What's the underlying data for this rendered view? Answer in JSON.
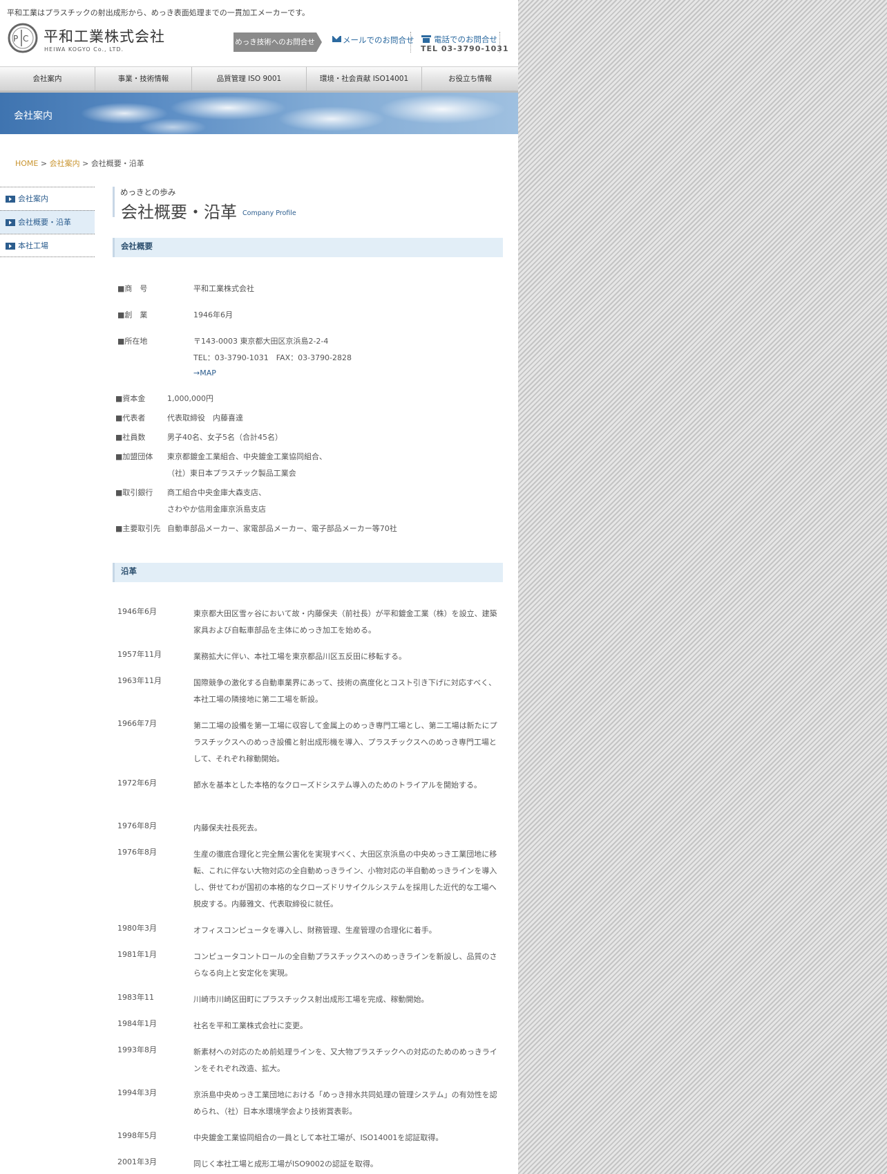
{
  "header": {
    "tagline": "平和工業はプラスチックの射出成形から、めっき表面処理までの一貫加工メーカーです。",
    "logo_name": "平和工業株式会社",
    "logo_sub": "HEIWA KOGYO Co., LTD.",
    "tech_contact": "めっき技術へのお問合せ",
    "mail_contact": "メールでのお問合せ",
    "phone_contact": "電話でのお問合せ",
    "phone_number": "TEL 03-3790-1031"
  },
  "nav": {
    "items": [
      {
        "label": "会社案内"
      },
      {
        "label": "事業・技術情報"
      },
      {
        "label": "品質管理 ISO 9001"
      },
      {
        "label": "環境・社会貢献 ISO14001"
      },
      {
        "label": "お役立ち情報"
      }
    ]
  },
  "banner": {
    "title": "会社案内"
  },
  "breadcrumb": {
    "home": "HOME",
    "sep": " > ",
    "parent": "会社案内",
    "current": "会社概要・沿革"
  },
  "sidebar": {
    "items": [
      {
        "label": "会社案内"
      },
      {
        "label": "会社概要・沿革"
      },
      {
        "label": "本社工場"
      }
    ]
  },
  "page_title": {
    "sub": "めっきとの歩み",
    "main": "会社概要・沿革",
    "en": "Company Profile"
  },
  "overview": {
    "heading": "会社概要",
    "rows": [
      {
        "key": "■商　号",
        "lines": [
          "平和工業株式会社"
        ]
      },
      {
        "key": "■創　業",
        "lines": [
          "1946年6月"
        ]
      },
      {
        "key": "■所在地",
        "lines": [
          "〒143-0003 東京都大田区京浜島2-2-4",
          "TEL：03-3790-1031　FAX：03-3790-2828"
        ],
        "link": "→MAP"
      },
      {
        "key": "■資本金",
        "lines": [
          "1,000,000円"
        ]
      },
      {
        "key": "■代表者",
        "lines": [
          "代表取締役　内藤喜達"
        ]
      },
      {
        "key": "■社員数",
        "lines": [
          "男子40名、女子5名（合計45名）"
        ]
      },
      {
        "key": "■加盟団体",
        "lines": [
          "東京都鍍金工業組合、中央鍍金工業協同組合、",
          "（社）東日本プラスチック製品工業会"
        ]
      },
      {
        "key": "■取引銀行",
        "lines": [
          "商工組合中央金庫大森支店、",
          "さわやか信用金庫京浜島支店"
        ]
      },
      {
        "key": "■主要取引先",
        "lines": [
          "自動車部品メーカー、家電部品メーカー、電子部品メーカー等70社"
        ]
      }
    ]
  },
  "history": {
    "heading": "沿革",
    "items": [
      {
        "date": "1946年6月",
        "text": "東京都大田区雪ヶ谷において故・内藤保夫（前社長）が平和鍍金工業（株）を設立、建築家具および自転車部品を主体にめっき加工を始める。"
      },
      {
        "date": "1957年11月",
        "text": "業務拡大に伴い、本社工場を東京都品川区五反田に移転する。"
      },
      {
        "date": "1963年11月",
        "text": "国際競争の激化する自動車業界にあって、技術の高度化とコスト引き下げに対応すべく、本社工場の隣接地に第二工場を新設。"
      },
      {
        "date": "1966年7月",
        "text": "第二工場の設備を第一工場に収容して金属上のめっき専門工場とし、第二工場は新たにプラスチックスへのめっき設備と射出成形機を導入、プラスチックスへのめっき専門工場として、それぞれ稼動開始。"
      },
      {
        "date": "1972年6月",
        "text": "節水を基本とした本格的なクローズドシステム導入のためのトライアルを開始する。"
      },
      {
        "date": "1976年8月",
        "text": "内藤保夫社長死去。"
      },
      {
        "date": "1976年8月",
        "text": "生産の徹底合理化と完全無公害化を実現すべく、大田区京浜島の中央めっき工業団地に移転、これに伴ない大物対応の全自動めっきライン、小物対応の半自動めっきラインを導入し、併せてわが国初の本格的なクローズドリサイクルシステムを採用した近代的な工場へ脱皮する。内藤雅文、代表取締役に就任。"
      },
      {
        "date": "1980年3月",
        "text": "オフィスコンピュータを導入し、財務管理、生産管理の合理化に着手。"
      },
      {
        "date": "1981年1月",
        "text": "コンピュータコントロールの全自動プラスチックスへのめっきラインを新設し、品質のさらなる向上と安定化を実現。"
      },
      {
        "date": "1983年11",
        "text": "川崎市川崎区田町にプラスチックス射出成形工場を完成、稼動開始。"
      },
      {
        "date": "1984年1月",
        "text": "社名を平和工業株式会社に変更。"
      },
      {
        "date": "1993年8月",
        "text": "新素材への対応のため前処理ラインを、又大物プラスチックへの対応のためのめっきラインをそれぞれ改造、拡大。"
      },
      {
        "date": "1994年3月",
        "text": "京浜島中央めっき工業団地における「めっき排水共同処理の管理システム」の有効性を認められ、（社）日本水環境学会より技術賞表彰。"
      },
      {
        "date": "1998年5月",
        "text": "中央鍍金工業協同組合の一員として本社工場が、ISO14001を認証取得。"
      },
      {
        "date": "2001年3月",
        "text": "同じく本社工場と成形工場がISO9002の認証を取得。"
      }
    ]
  }
}
